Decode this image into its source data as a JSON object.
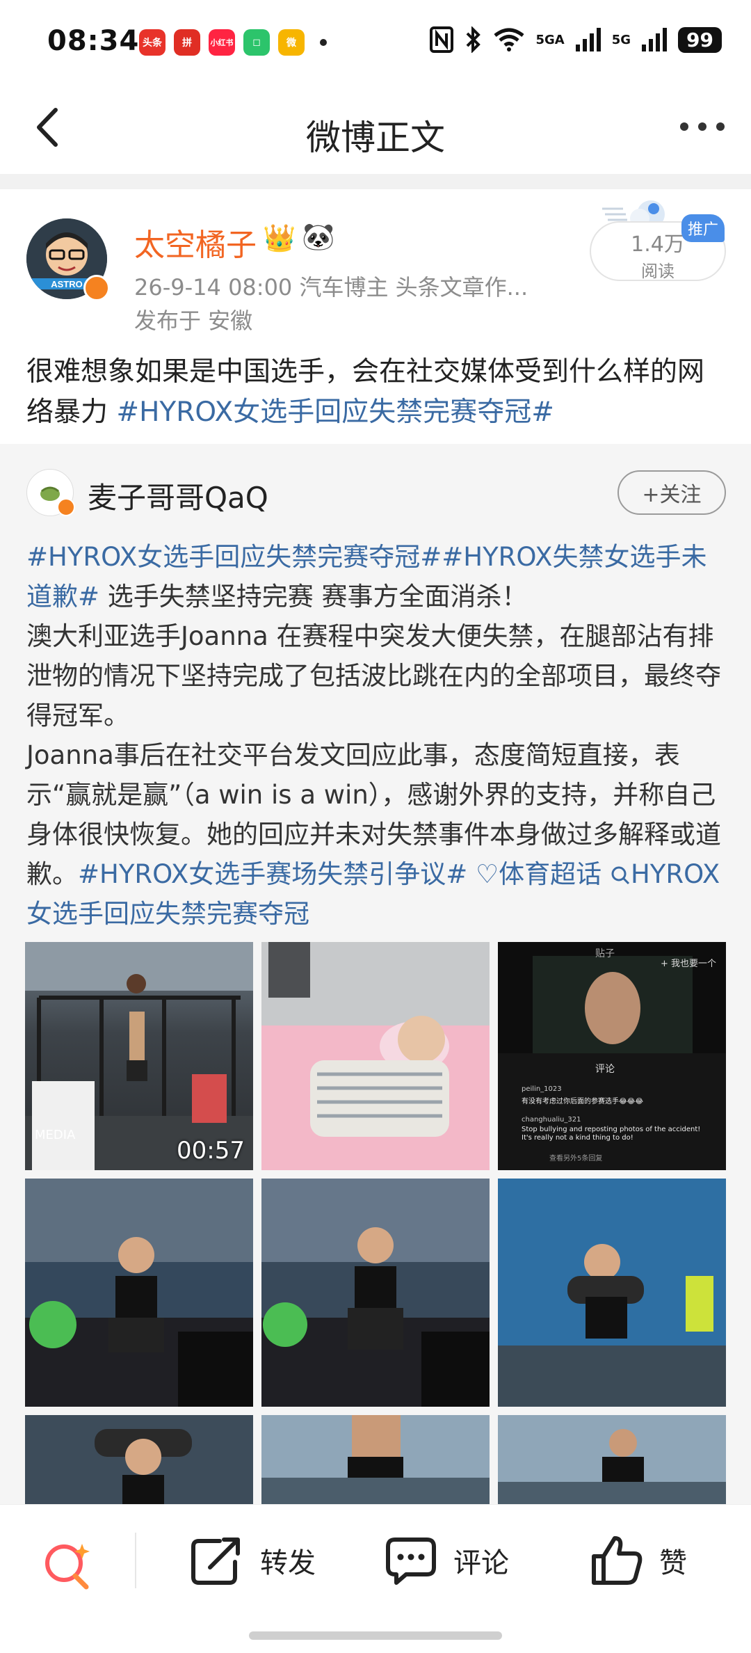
{
  "status_bar": {
    "time": "08:34",
    "apps": [
      {
        "name": "toutiao",
        "label": "头条",
        "color": "#e8332a"
      },
      {
        "name": "pinduoduo",
        "label": "拼",
        "color": "#e02e24"
      },
      {
        "name": "xiaohongshu",
        "label": "小红书",
        "color": "#ff2442"
      },
      {
        "name": "bilibili-like",
        "label": "◻",
        "color": "#2cc46b"
      },
      {
        "name": "weibo",
        "label": "微",
        "color": "#f7b500"
      }
    ],
    "signal1": "5GA",
    "signal2": "5G",
    "battery": "99"
  },
  "nav": {
    "title": "微博正文"
  },
  "post": {
    "username": "太空橘子",
    "meta": "26-9-14 08:00   汽车博主 头条文章作...",
    "location": "发布于 安徽",
    "reads_count": "1.4万",
    "reads_label": "阅读",
    "promo": "推广",
    "text_plain": "很难想象如果是中国选手，会在社交媒体受到什么样的网络暴力 ",
    "text_hashtag": "#HYROX女选手回应失禁完赛夺冠#"
  },
  "retweet": {
    "username": "麦子哥哥QaQ",
    "follow_label": "+关注",
    "hashtag1": "#HYROX女选手回应失禁完赛夺冠##HYROX失禁女选手未道歉#",
    "line1_rest": " 选手失禁坚持完赛 赛事方全面消杀！",
    "para2": "澳大利亚选手Joanna 在赛程中突发大便失禁，在腿部沾有排泄物的情况下坚持完成了包括波比跳在内的全部项目，最终夺得冠军。",
    "para3": "Joanna事后在社交平台发文回应此事，态度简短直接，表示“赢就是赢”（a win is a win），感谢外界的支持，并称自己身体很快恢复。她的回应并未对失禁事件本身做过多解释或道歉。",
    "hashtag2": "#HYROX女选手赛场失禁引争议#",
    "supertopic": "♡体育超话",
    "search_topic": "HYROX女选手回应失禁完赛夺冠",
    "video_duration": "00:57",
    "media_watermark": "MEDIA",
    "comment_screen": {
      "title": "评论",
      "header": "贴子",
      "user1": "peilin_1023",
      "comment1": "有没有考虑过你后面的参赛选手😂😂😂",
      "user2": "changhualiu_321",
      "comment2": "Stop bullying and reposting photos of the accident! It's really not a kind thing to do!",
      "more": "查看另外5条回复",
      "top_right": "+ 我也要一个"
    }
  },
  "bottom_bar": {
    "repost": "转发",
    "comment": "评论",
    "like": "赞"
  },
  "colors": {
    "accent_orange": "#f26522",
    "hashtag_blue": "#3a6aa3",
    "retweet_bg": "#f5f5f5"
  }
}
